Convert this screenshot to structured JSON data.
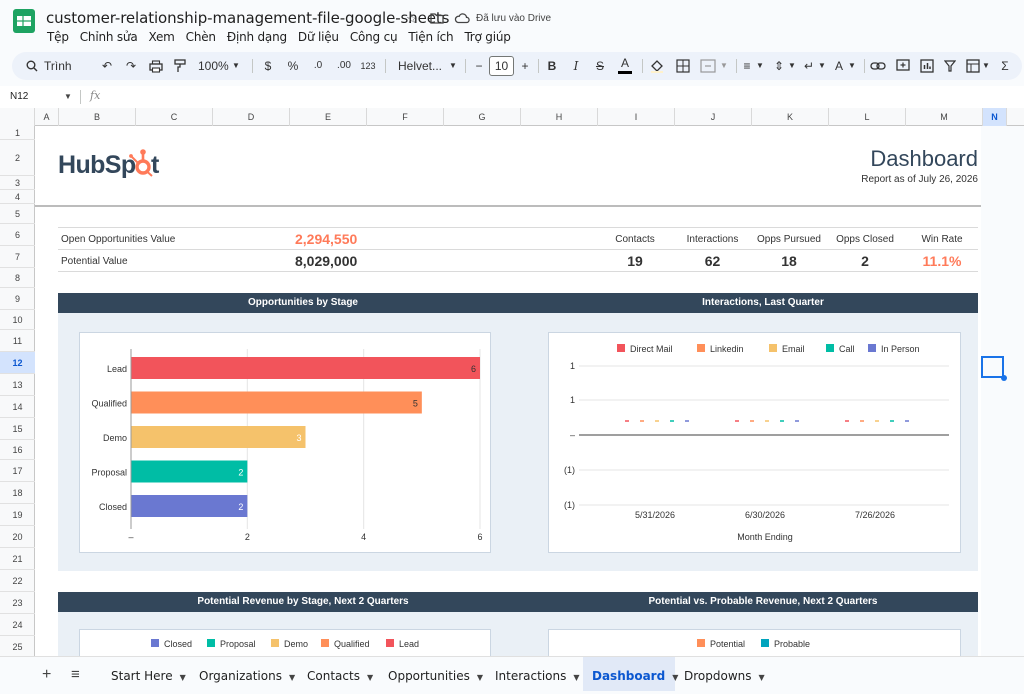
{
  "window": {
    "doc_title": "customer-relationship-management-file-google-sheets",
    "saved_status": "Đã lưu vào Drive"
  },
  "menu": [
    "Tệp",
    "Chỉnh sửa",
    "Xem",
    "Chèn",
    "Định dạng",
    "Dữ liệu",
    "Công cụ",
    "Tiện ích",
    "Trợ giúp"
  ],
  "toolbar": {
    "search_label": "Trình đơn",
    "zoom": "100%",
    "currency": "$",
    "percent": "%",
    "dec_decrease": ".0",
    "dec_increase": ".00",
    "number_format": "123",
    "font": "Helvet...",
    "font_size": "10"
  },
  "formula_bar": {
    "cell_ref": "N12",
    "fx": "fx"
  },
  "columns": [
    "A",
    "B",
    "C",
    "D",
    "E",
    "F",
    "G",
    "H",
    "I",
    "J",
    "K",
    "L",
    "M",
    "N"
  ],
  "rows": [
    "1",
    "2",
    "3",
    "4",
    "5",
    "6",
    "7",
    "8",
    "9",
    "10",
    "11",
    "12",
    "13",
    "14",
    "15",
    "16",
    "17",
    "18",
    "19",
    "20",
    "21",
    "22",
    "23",
    "24",
    "25"
  ],
  "selected_cell": {
    "col": "N",
    "row": "12"
  },
  "brand": {
    "logo_text": "HubSpot",
    "accent": "#ff7a59",
    "navy": "#33475b"
  },
  "header": {
    "title": "Dashboard",
    "subtitle": "Report as of July 26, 2026"
  },
  "kpis": {
    "open_opps_label": "Open Opportunities Value",
    "open_opps_value": "2,294,550",
    "potential_label": "Potential Value",
    "potential_value": "8,029,000",
    "metrics": [
      {
        "label": "Contacts",
        "value": "19"
      },
      {
        "label": "Interactions",
        "value": "62"
      },
      {
        "label": "Opps Pursued",
        "value": "18"
      },
      {
        "label": "Opps Closed",
        "value": "2"
      },
      {
        "label": "Win Rate",
        "value": "11.1%"
      }
    ]
  },
  "sections": {
    "opps_by_stage": "Opportunities by Stage",
    "interactions_last_quarter": "Interactions, Last Quarter",
    "potential_revenue": "Potential Revenue by Stage, Next 2 Quarters",
    "potential_vs_probable": "Potential vs. Probable Revenue, Next 2 Quarters"
  },
  "chart_data": [
    {
      "type": "bar",
      "orientation": "horizontal",
      "title": "Opportunities by Stage",
      "categories": [
        "Lead",
        "Qualified",
        "Demo",
        "Proposal",
        "Closed"
      ],
      "values": [
        6,
        5,
        3,
        2,
        2
      ],
      "colors": [
        "#f2545b",
        "#ff8f59",
        "#f5c26b",
        "#00bda5",
        "#6a78d1"
      ],
      "xlim": [
        0,
        6
      ],
      "x_ticks": [
        "–",
        "2",
        "4",
        "6"
      ]
    },
    {
      "type": "line",
      "title": "Interactions, Last Quarter",
      "series": [
        {
          "name": "Direct Mail",
          "color": "#f2545b"
        },
        {
          "name": "Linkedin",
          "color": "#ff8f59"
        },
        {
          "name": "Email",
          "color": "#f5c26b"
        },
        {
          "name": "Call",
          "color": "#00bda5"
        },
        {
          "name": "In Person",
          "color": "#6a78d1"
        }
      ],
      "x": [
        "5/31/2026",
        "6/30/2026",
        "7/26/2026"
      ],
      "y_ticks": [
        "1",
        "1",
        "–",
        "(1)",
        "(1)"
      ],
      "xlabel": "Month Ending",
      "legend": "top"
    },
    {
      "type": "bar",
      "title": "Potential Revenue by Stage, Next 2 Quarters",
      "series": [
        {
          "name": "Closed",
          "color": "#6a78d1"
        },
        {
          "name": "Proposal",
          "color": "#00bda5"
        },
        {
          "name": "Demo",
          "color": "#f5c26b"
        },
        {
          "name": "Qualified",
          "color": "#ff8f59"
        },
        {
          "name": "Lead",
          "color": "#f2545b"
        }
      ],
      "legend": "top"
    },
    {
      "type": "bar",
      "title": "Potential vs. Probable Revenue, Next 2 Quarters",
      "series": [
        {
          "name": "Potential",
          "color": "#ff8f59"
        },
        {
          "name": "Probable",
          "color": "#00a4bd"
        }
      ],
      "legend": "top"
    }
  ],
  "sheet_tabs": [
    {
      "label": "Start Here"
    },
    {
      "label": "Organizations"
    },
    {
      "label": "Contacts"
    },
    {
      "label": "Opportunities"
    },
    {
      "label": "Interactions"
    },
    {
      "label": "Dashboard",
      "active": true
    },
    {
      "label": "Dropdowns"
    }
  ],
  "icons": {
    "sheets_logo": "sheets-logo-icon",
    "star": "star-icon",
    "move": "folder-move-icon",
    "cloud": "cloud-saved-icon"
  }
}
